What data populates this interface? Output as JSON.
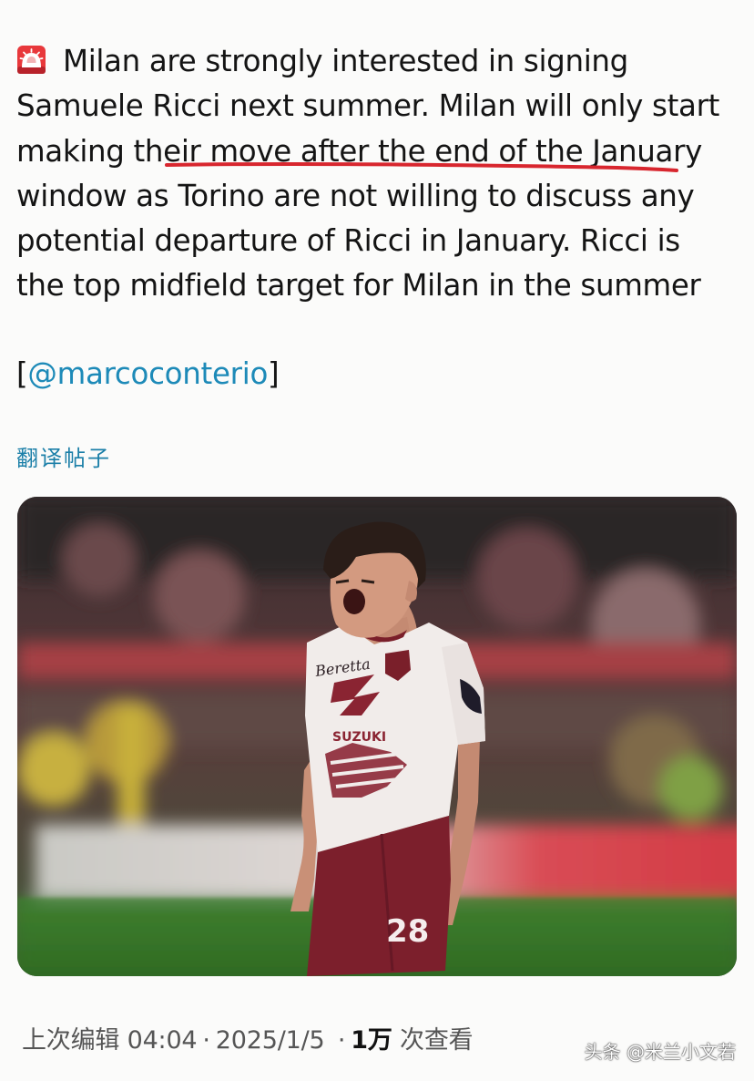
{
  "tweet": {
    "lines": [
      "Milan are strongly interested in signing",
      "Samuele Ricci next summer. Milan will only start",
      "making their move after the end of the January",
      "window as Torino are not willing to discuss any",
      "potential departure of Ricci in January. Ricci is",
      "the top midfield target for Milan in the summer"
    ],
    "mention_open": "[",
    "mention": "@marcoconterio",
    "mention_close": "]",
    "lead_icon": "siren-emoji-icon"
  },
  "translate_label": "翻译帖子",
  "media": {
    "jersey_sponsor_top": "Beretta",
    "jersey_sponsor_main": "SUZUKI",
    "jersey_number": "28"
  },
  "meta": {
    "edited_label": "上次编辑",
    "time": "04:04",
    "separator": "·",
    "date": "2025/1/5",
    "views_count": "1万",
    "views_label": "次查看"
  },
  "watermark": "头条 @米兰小文若",
  "colors": {
    "link": "#1d8ab8",
    "underline": "#d8262e",
    "text": "#141414"
  }
}
